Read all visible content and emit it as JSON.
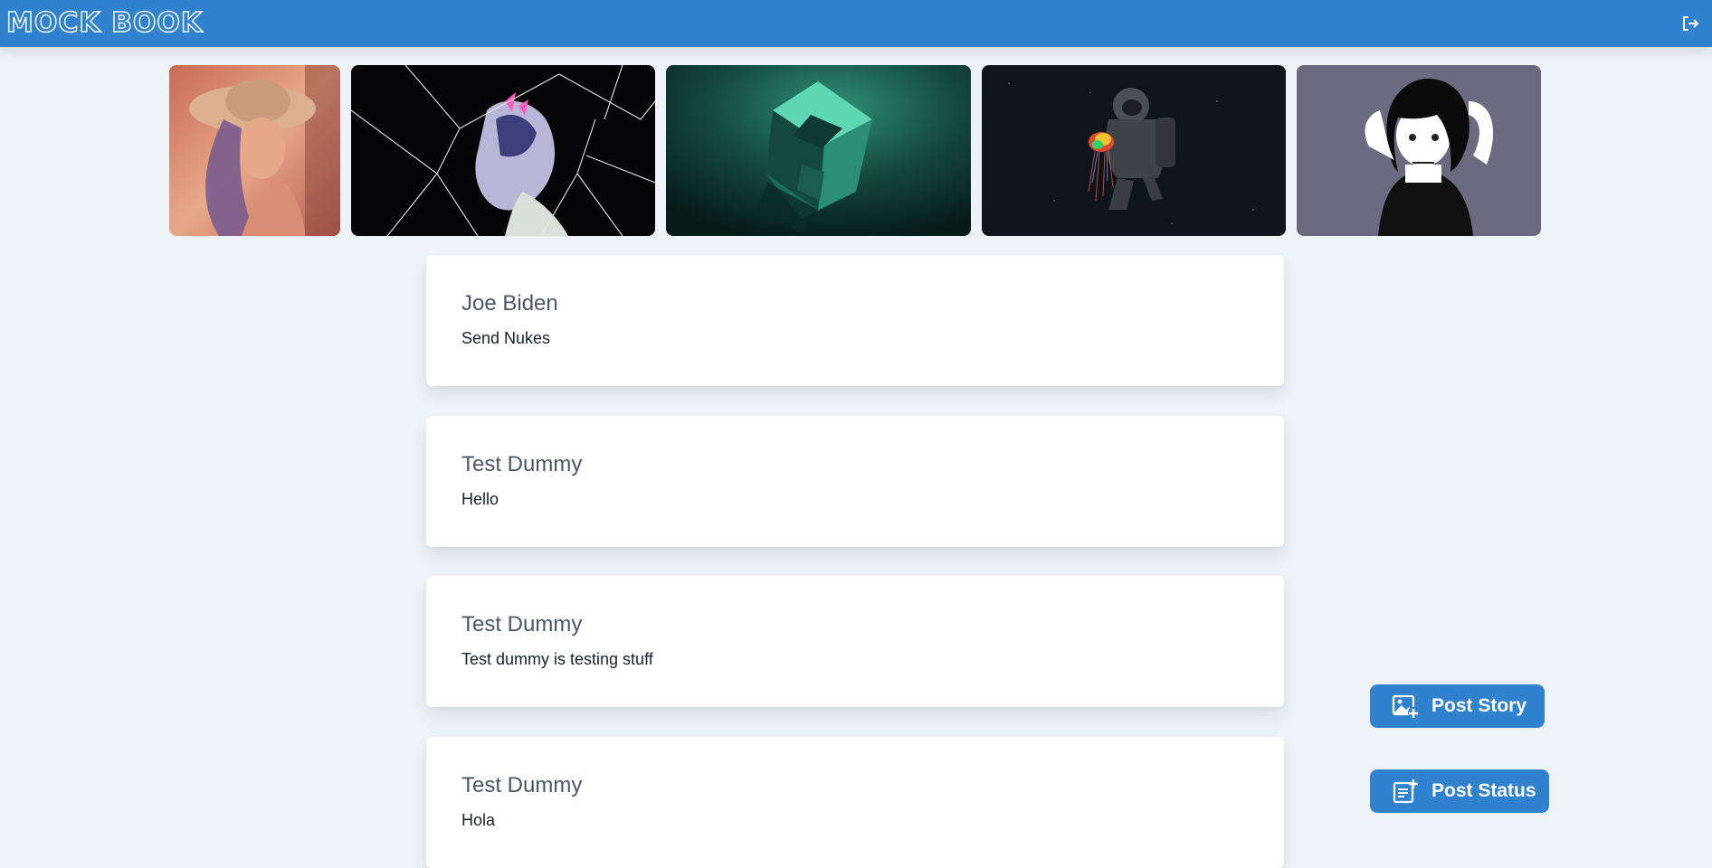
{
  "app": {
    "title": "MOCK BOOK"
  },
  "header": {
    "logout_icon": "logout-icon"
  },
  "stories": [
    {
      "label": "story-portrait-hat",
      "icon": "image"
    },
    {
      "label": "story-shattered-glass",
      "icon": "image"
    },
    {
      "label": "story-green-cube",
      "icon": "image"
    },
    {
      "label": "story-astronaut-jellyfish",
      "icon": "image"
    },
    {
      "label": "story-anime-girl",
      "icon": "image"
    }
  ],
  "feed": {
    "posts": [
      {
        "author": "Joe Biden",
        "text": "Send Nukes"
      },
      {
        "author": "Test Dummy",
        "text": "Hello"
      },
      {
        "author": "Test Dummy",
        "text": "Test dummy is testing stuff"
      },
      {
        "author": "Test Dummy",
        "text": "Hola"
      }
    ]
  },
  "actions": {
    "post_story_label": "Post Story",
    "post_story_icon": "image-plus-icon",
    "post_status_label": "Post Status",
    "post_status_icon": "note-plus-icon"
  },
  "colors": {
    "brand": "#3182ce",
    "background": "#edf2f7",
    "card": "#ffffff"
  }
}
